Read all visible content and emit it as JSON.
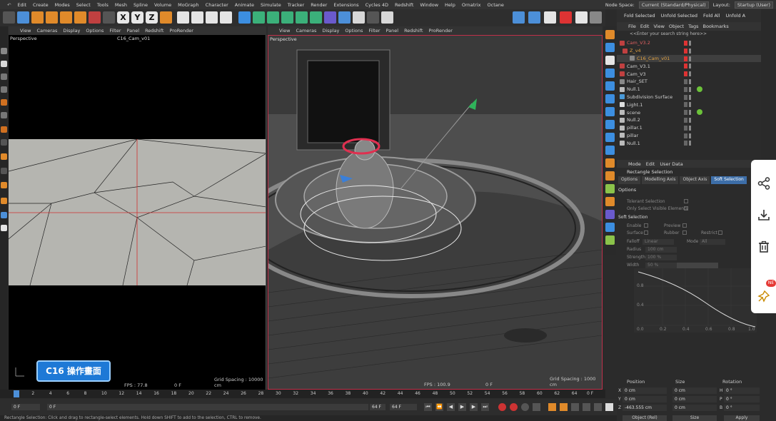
{
  "menubar": {
    "items": [
      "Edit",
      "Create",
      "Modes",
      "Select",
      "Tools",
      "Mesh",
      "Spline",
      "Volume",
      "MoGraph",
      "Character",
      "Animate",
      "Simulate",
      "Tracker",
      "Render",
      "Extensions",
      "Cycles 4D",
      "Redshift",
      "Window",
      "Help",
      "Ornatrix",
      "Octane"
    ],
    "node_space_label": "Node Space:",
    "node_space_value": "Current (Standard/Physical)",
    "layout_label": "Layout:",
    "layout_value": "Startup (User)"
  },
  "toolbar": {
    "axis_x": "X",
    "axis_y": "Y",
    "axis_z": "Z"
  },
  "viewport_left": {
    "menu": [
      "View",
      "Cameras",
      "Display",
      "Options",
      "Filter",
      "Panel",
      "Redshift",
      "ProRender"
    ],
    "label": "Perspective",
    "camera": "C16_Cam_v01",
    "fps": "FPS : 77.8",
    "frame": "0 F",
    "grid": "Grid Spacing : 10000 cm",
    "overlay_button": "C16 操作畫面"
  },
  "viewport_right": {
    "menu": [
      "View",
      "Cameras",
      "Display",
      "Options",
      "Filter",
      "Panel",
      "Redshift",
      "ProRender"
    ],
    "label": "Perspective",
    "fps": "FPS : 100.9",
    "frame": "0 F",
    "grid": "Grid Spacing : 1000 cm"
  },
  "object_manager": {
    "top_buttons": [
      "Fold Selected",
      "Unfold Selected",
      "Fold All",
      "Unfold A"
    ],
    "menu": [
      "File",
      "Edit",
      "View",
      "Object",
      "Tags",
      "Bookmarks"
    ],
    "search_placeholder": "<<Enter your search string here>>",
    "objects": [
      {
        "name": "Cam_V3.2",
        "color": "#e06060",
        "icon": "#c04040"
      },
      {
        "name": "Z_v4",
        "color": "#e0a040",
        "icon": "#c04040"
      },
      {
        "name": "C16_Cam_v01",
        "color": "#e0a040",
        "icon": "#888888"
      },
      {
        "name": "Cam_V3.1",
        "color": "#d0d0d0",
        "icon": "#c04040"
      },
      {
        "name": "Cam_V3",
        "color": "#d0d0d0",
        "icon": "#c04040"
      },
      {
        "name": "Hair_SET",
        "color": "#d0d0d0",
        "icon": "#888888"
      },
      {
        "name": "Null.1",
        "color": "#d0d0d0",
        "icon": "#bbbbbb"
      },
      {
        "name": "Subdivision Surface",
        "color": "#d0d0d0",
        "icon": "#4a9ad8"
      },
      {
        "name": "Light.1",
        "color": "#d0d0d0",
        "icon": "#dddddd"
      },
      {
        "name": "scene",
        "color": "#d0d0d0",
        "icon": "#bbbbbb"
      },
      {
        "name": "Null.2",
        "color": "#d0d0d0",
        "icon": "#bbbbbb"
      },
      {
        "name": "pillar.1",
        "color": "#d0d0d0",
        "icon": "#bbbbbb"
      },
      {
        "name": "pillar",
        "color": "#d0d0d0",
        "icon": "#bbbbbb"
      },
      {
        "name": "Null.1",
        "color": "#d0d0d0",
        "icon": "#bbbbbb"
      }
    ]
  },
  "attributes": {
    "menu": [
      "Mode",
      "Edit",
      "User Data"
    ],
    "title": "Rectangle Selection",
    "tabs": [
      "Options",
      "Modelling Axis",
      "Object Axis",
      "Soft Selection"
    ],
    "options_heading": "Options",
    "tolerant_selection": "Tolerant Selection",
    "only_visible": "Only Select Visible Elements",
    "soft_heading": "Soft Selection",
    "enable": "Enable",
    "preview": "Preview",
    "surface": "Surface",
    "rubber": "Rubber",
    "restrict": "Restrict",
    "falloff_label": "Falloff",
    "falloff_value": "Linear",
    "mode_label": "Mode",
    "mode_value": "All",
    "radius_label": "Radius",
    "radius_value": "100 cm",
    "strength_label": "Strength",
    "strength_value": "100 %",
    "width_label": "Width",
    "width_value": "50 %",
    "graph_y": [
      "0.8",
      "0.4"
    ],
    "graph_x": [
      "0.0",
      "0.2",
      "0.4",
      "0.6",
      "0.8",
      "1.0"
    ]
  },
  "coordinates": {
    "headers": [
      "Position",
      "Size",
      "Rotation"
    ],
    "rows": [
      {
        "axis": "X",
        "pos": "0 cm",
        "size": "0 cm",
        "rot_axis": "H",
        "rot": "0 °"
      },
      {
        "axis": "Y",
        "pos": "0 cm",
        "size": "0 cm",
        "rot_axis": "P",
        "rot": "0 °"
      },
      {
        "axis": "Z",
        "pos": "-463.555 cm",
        "size": "0 cm",
        "rot_axis": "B",
        "rot": "0 °"
      }
    ],
    "mode_object": "Object (Rel)",
    "mode_size": "Size",
    "apply": "Apply"
  },
  "timeline": {
    "ticks": [
      "0",
      "2",
      "4",
      "6",
      "8",
      "10",
      "12",
      "14",
      "16",
      "18",
      "20",
      "22",
      "24",
      "26",
      "28",
      "30",
      "32",
      "34",
      "36",
      "38",
      "40",
      "42",
      "44",
      "46",
      "48",
      "50",
      "52",
      "54",
      "56",
      "58",
      "60",
      "62",
      "64"
    ],
    "end_label": "0 F",
    "start_field": "0 F",
    "min_field": "0 F",
    "max_field": "64 F",
    "end_field": "64 F"
  },
  "status_text": "Rectangle Selection: Click and drag to rectangle-select elements. Hold down SHIFT to add to the selection, CTRL to remove.",
  "share_panel": {
    "badge": "NE"
  }
}
